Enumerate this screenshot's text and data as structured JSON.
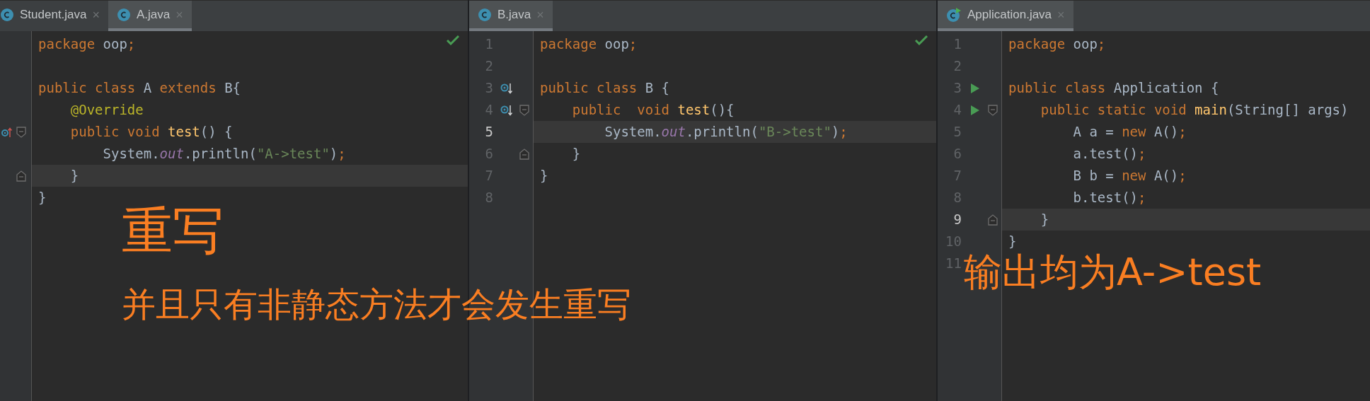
{
  "panes": [
    {
      "tabs": [
        {
          "label": "Student.java",
          "close": "×",
          "selected": false
        },
        {
          "label": "A.java",
          "close": "×",
          "selected": true
        }
      ],
      "inspection_ok": true,
      "lines": [
        {
          "current": false,
          "tokens": [
            {
              "text": "package ",
              "kind": "keyword"
            },
            {
              "text": "oop",
              "kind": "plain"
            },
            {
              "text": ";",
              "kind": "keyword"
            }
          ]
        },
        {
          "current": false
        },
        {
          "current": false,
          "tokens": [
            {
              "text": "public class ",
              "kind": "keyword"
            },
            {
              "text": "A ",
              "kind": "plain"
            },
            {
              "text": "extends ",
              "kind": "keyword"
            },
            {
              "text": "B{",
              "kind": "plain"
            }
          ]
        },
        {
          "current": false,
          "tokens": [
            {
              "text": "    @Override",
              "kind": "annotation"
            }
          ]
        },
        {
          "current": false,
          "gutter": [
            {
              "kind": "overrides"
            },
            {
              "kind": "fold_start"
            }
          ],
          "tokens": [
            {
              "text": "    public void ",
              "kind": "keyword"
            },
            {
              "text": "test",
              "kind": "method"
            },
            {
              "text": "() {",
              "kind": "plain"
            }
          ]
        },
        {
          "current": false,
          "tokens": [
            {
              "text": "        System.",
              "kind": "plain"
            },
            {
              "text": "out",
              "kind": "field"
            },
            {
              "text": ".println(",
              "kind": "plain"
            },
            {
              "text": "\"A->test\"",
              "kind": "string"
            },
            {
              "text": ")",
              "kind": "plain"
            },
            {
              "text": ";",
              "kind": "keyword"
            }
          ]
        },
        {
          "current": true,
          "gutter": [
            {
              "kind": "fold_end"
            }
          ],
          "tokens": [
            {
              "text": "    }",
              "kind": "plain"
            }
          ]
        },
        {
          "current": false,
          "tokens": [
            {
              "text": "}",
              "kind": "plain"
            }
          ]
        }
      ]
    },
    {
      "tabs": [
        {
          "label": "B.java",
          "close": "×",
          "selected": true
        }
      ],
      "inspection_ok": true,
      "lines": [
        {
          "number": "1",
          "current": false,
          "tokens": [
            {
              "text": "package ",
              "kind": "keyword"
            },
            {
              "text": "oop",
              "kind": "plain"
            },
            {
              "text": ";",
              "kind": "keyword"
            }
          ]
        },
        {
          "number": "2",
          "current": false
        },
        {
          "number": "3",
          "current": false,
          "gutter": [
            {
              "kind": "overridden"
            }
          ],
          "tokens": [
            {
              "text": "public class ",
              "kind": "keyword"
            },
            {
              "text": "B {",
              "kind": "plain"
            }
          ]
        },
        {
          "number": "4",
          "current": false,
          "gutter": [
            {
              "kind": "overridden"
            },
            {
              "kind": "fold_start"
            }
          ],
          "tokens": [
            {
              "text": "    public  void ",
              "kind": "keyword"
            },
            {
              "text": "test",
              "kind": "method"
            },
            {
              "text": "(){",
              "kind": "plain"
            }
          ]
        },
        {
          "number": "5",
          "current": true,
          "tokens": [
            {
              "text": "        System.",
              "kind": "plain"
            },
            {
              "text": "out",
              "kind": "field"
            },
            {
              "text": ".println(",
              "kind": "plain"
            },
            {
              "text": "\"B->test\"",
              "kind": "string"
            },
            {
              "text": ")",
              "kind": "plain"
            },
            {
              "text": ";",
              "kind": "keyword"
            }
          ]
        },
        {
          "number": "6",
          "current": false,
          "gutter": [
            {
              "kind": "fold_end"
            }
          ],
          "tokens": [
            {
              "text": "    }",
              "kind": "plain"
            }
          ]
        },
        {
          "number": "7",
          "current": false,
          "tokens": [
            {
              "text": "}",
              "kind": "plain"
            }
          ]
        },
        {
          "number": "8",
          "current": false
        }
      ]
    },
    {
      "tabs": [
        {
          "label": "Application.java",
          "close": "×",
          "selected": true
        }
      ],
      "lines": [
        {
          "number": "1",
          "current": false,
          "tokens": [
            {
              "text": "package ",
              "kind": "keyword"
            },
            {
              "text": "oop",
              "kind": "plain"
            },
            {
              "text": ";",
              "kind": "keyword"
            }
          ]
        },
        {
          "number": "2",
          "current": false
        },
        {
          "number": "3",
          "current": false,
          "gutter": [
            {
              "kind": "run"
            }
          ],
          "tokens": [
            {
              "text": "public class ",
              "kind": "keyword"
            },
            {
              "text": "Application {",
              "kind": "plain"
            }
          ]
        },
        {
          "number": "4",
          "current": false,
          "gutter": [
            {
              "kind": "run"
            },
            {
              "kind": "fold_start"
            }
          ],
          "tokens": [
            {
              "text": "    public static void ",
              "kind": "keyword"
            },
            {
              "text": "main",
              "kind": "method"
            },
            {
              "text": "(String[] args)",
              "kind": "plain"
            }
          ]
        },
        {
          "number": "5",
          "current": false,
          "tokens": [
            {
              "text": "        A a = ",
              "kind": "plain"
            },
            {
              "text": "new ",
              "kind": "keyword"
            },
            {
              "text": "A()",
              "kind": "plain"
            },
            {
              "text": ";",
              "kind": "keyword"
            }
          ]
        },
        {
          "number": "6",
          "current": false,
          "tokens": [
            {
              "text": "        a.test()",
              "kind": "plain"
            },
            {
              "text": ";",
              "kind": "keyword"
            }
          ]
        },
        {
          "number": "7",
          "current": false,
          "tokens": [
            {
              "text": "        B b = ",
              "kind": "plain"
            },
            {
              "text": "new ",
              "kind": "keyword"
            },
            {
              "text": "A()",
              "kind": "plain"
            },
            {
              "text": ";",
              "kind": "keyword"
            }
          ]
        },
        {
          "number": "8",
          "current": false,
          "tokens": [
            {
              "text": "        b.test()",
              "kind": "plain"
            },
            {
              "text": ";",
              "kind": "keyword"
            }
          ]
        },
        {
          "number": "9",
          "current": true,
          "gutter": [
            {
              "kind": "fold_end"
            }
          ],
          "tokens": [
            {
              "text": "    }",
              "kind": "plain"
            }
          ]
        },
        {
          "number": "10",
          "current": false,
          "tokens": [
            {
              "text": "}",
              "kind": "plain"
            }
          ]
        },
        {
          "number": "11",
          "current": false
        }
      ]
    }
  ],
  "annotations": [
    {
      "text": "重写",
      "kind": "title"
    },
    {
      "text": "并且只有非静态方法才会发生重写",
      "kind": "subtitle"
    },
    {
      "text": "输出均为A->test",
      "kind": "result"
    }
  ]
}
